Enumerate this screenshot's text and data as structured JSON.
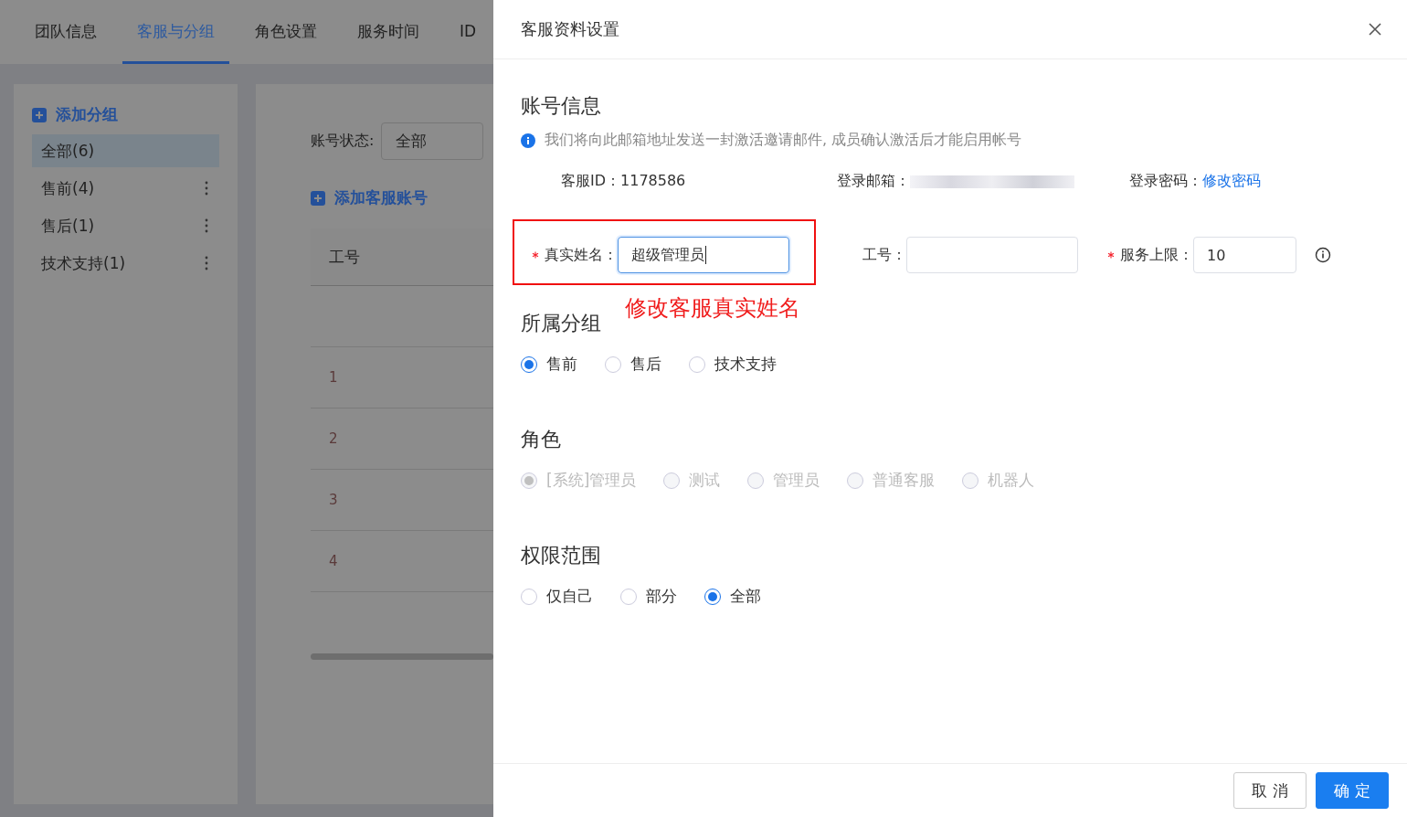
{
  "tabs": [
    {
      "label": "团队信息",
      "selected": false
    },
    {
      "label": "客服与分组",
      "selected": true
    },
    {
      "label": "角色设置",
      "selected": false
    },
    {
      "label": "服务时间",
      "selected": false
    },
    {
      "label": "ID",
      "selected": false
    }
  ],
  "sidebar": {
    "add_group": "添加分组",
    "groups": [
      {
        "label": "全部(6)",
        "selected": true,
        "has_menu": false
      },
      {
        "label": "售前(4)",
        "selected": false,
        "has_menu": true
      },
      {
        "label": "售后(1)",
        "selected": false,
        "has_menu": true
      },
      {
        "label": "技术支持(1)",
        "selected": false,
        "has_menu": true
      }
    ]
  },
  "list_panel": {
    "status_label": "账号状态:",
    "status_value": "全部",
    "add_account": "添加客服账号",
    "column_1": "工号",
    "rows": [
      "1",
      "2",
      "3",
      "4"
    ]
  },
  "drawer": {
    "title": "客服资料设置",
    "account": {
      "heading": "账号信息",
      "notice": "我们将向此邮箱地址发送一封激活邀请邮件, 成员确认激活后才能启用帐号",
      "id_label": "客服ID：",
      "id_value": "1178586",
      "email_label": "登录邮箱：",
      "password_label": "登录密码：",
      "password_link": "修改密码"
    },
    "fields": [
      {
        "label": "真实姓名：",
        "required": true,
        "value": "超级管理员",
        "focused": true
      },
      {
        "label": "工号：",
        "required": false,
        "focused": false
      },
      {
        "label": "服务上限：",
        "required": true,
        "value": "10",
        "focused": false,
        "info": true
      }
    ],
    "annotation": "修改客服真实姓名",
    "sections": [
      {
        "heading": "所属分组",
        "options": [
          {
            "label": "售前",
            "selected": true,
            "disabled": false
          },
          {
            "label": "售后",
            "selected": false,
            "disabled": false
          },
          {
            "label": "技术支持",
            "selected": false,
            "disabled": false
          }
        ]
      },
      {
        "heading": "角色",
        "options": [
          {
            "label": "[系统]管理员",
            "selected": true,
            "disabled": true
          },
          {
            "label": "测试",
            "selected": false,
            "disabled": true
          },
          {
            "label": "管理员",
            "selected": false,
            "disabled": true
          },
          {
            "label": "普通客服",
            "selected": false,
            "disabled": true
          },
          {
            "label": "机器人",
            "selected": false,
            "disabled": true
          }
        ]
      },
      {
        "heading": "权限范围",
        "options": [
          {
            "label": "仅自己",
            "selected": false,
            "disabled": false
          },
          {
            "label": "部分",
            "selected": false,
            "disabled": false
          },
          {
            "label": "全部",
            "selected": true,
            "disabled": false
          }
        ]
      }
    ],
    "cancel": "取 消",
    "confirm": "确 定"
  }
}
